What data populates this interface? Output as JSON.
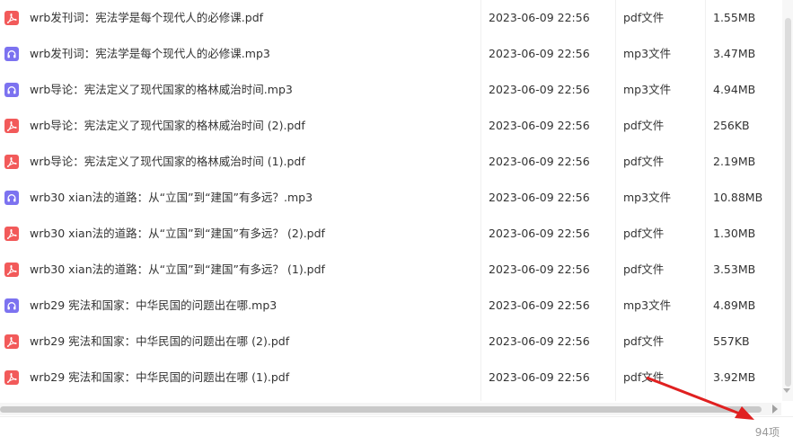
{
  "colors": {
    "pdf_icon": "#f25a5a",
    "mp3_icon": "#7c72f0",
    "arrow": "#e02020"
  },
  "files": [
    {
      "name": "wrb发刊词：宪法学是每个现代人的必修课.pdf",
      "date": "2023-06-09 22:56",
      "type": "pdf文件",
      "size": "1.55MB",
      "icon": "pdf"
    },
    {
      "name": "wrb发刊词：宪法学是每个现代人的必修课.mp3",
      "date": "2023-06-09 22:56",
      "type": "mp3文件",
      "size": "3.47MB",
      "icon": "mp3"
    },
    {
      "name": "wrb导论：宪法定义了现代国家的格林威治时间.mp3",
      "date": "2023-06-09 22:56",
      "type": "mp3文件",
      "size": "4.94MB",
      "icon": "mp3"
    },
    {
      "name": "wrb导论：宪法定义了现代国家的格林威治时间 (2).pdf",
      "date": "2023-06-09 22:56",
      "type": "pdf文件",
      "size": "256KB",
      "icon": "pdf"
    },
    {
      "name": "wrb导论：宪法定义了现代国家的格林威治时间 (1).pdf",
      "date": "2023-06-09 22:56",
      "type": "pdf文件",
      "size": "2.19MB",
      "icon": "pdf"
    },
    {
      "name": "wrb30  xian法的道路：从“立国”到“建国”有多远？.mp3",
      "date": "2023-06-09 22:56",
      "type": "mp3文件",
      "size": "10.88MB",
      "icon": "mp3"
    },
    {
      "name": "wrb30  xian法的道路：从“立国”到“建国”有多远？ (2).pdf",
      "date": "2023-06-09 22:56",
      "type": "pdf文件",
      "size": "1.30MB",
      "icon": "pdf"
    },
    {
      "name": "wrb30  xian法的道路：从“立国”到“建国”有多远？ (1).pdf",
      "date": "2023-06-09 22:56",
      "type": "pdf文件",
      "size": "3.53MB",
      "icon": "pdf"
    },
    {
      "name": "wrb29  宪法和国家：中华民国的问题出在哪.mp3",
      "date": "2023-06-09 22:56",
      "type": "mp3文件",
      "size": "4.89MB",
      "icon": "mp3"
    },
    {
      "name": "wrb29  宪法和国家：中华民国的问题出在哪 (2).pdf",
      "date": "2023-06-09 22:56",
      "type": "pdf文件",
      "size": "557KB",
      "icon": "pdf"
    },
    {
      "name": "wrb29  宪法和国家：中华民国的问题出在哪 (1).pdf",
      "date": "2023-06-09 22:56",
      "type": "pdf文件",
      "size": "3.92MB",
      "icon": "pdf"
    }
  ],
  "footer": {
    "item_count": "94项"
  }
}
